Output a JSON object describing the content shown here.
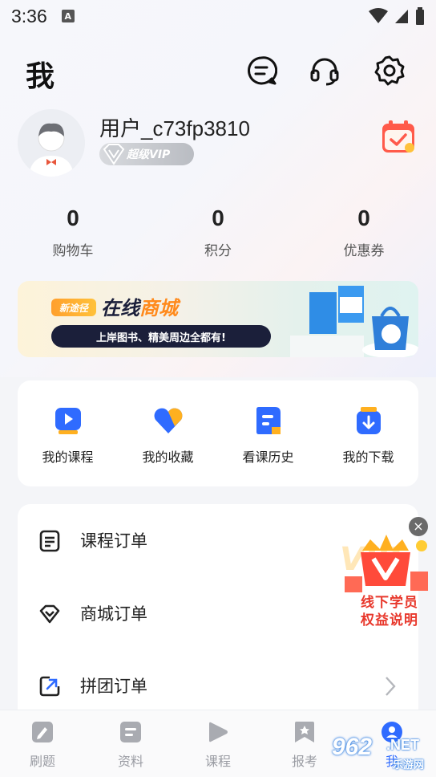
{
  "status_bar": {
    "time": "3:36",
    "badge": "A"
  },
  "header": {
    "title": "我"
  },
  "profile": {
    "username": "用户_c73fp3810",
    "vip_label": "超级VIP"
  },
  "stats": [
    {
      "value": "0",
      "label": "购物车"
    },
    {
      "value": "0",
      "label": "积分"
    },
    {
      "value": "0",
      "label": "优惠券"
    }
  ],
  "banner": {
    "tag": "新途径",
    "title_a": "在线",
    "title_b": "商城",
    "subtitle": "上岸图书、精美周边全都有!"
  },
  "quick_links": [
    {
      "label": "我的课程",
      "icon": "play-icon"
    },
    {
      "label": "我的收藏",
      "icon": "heart-icon"
    },
    {
      "label": "看课历史",
      "icon": "history-icon"
    },
    {
      "label": "我的下载",
      "icon": "download-icon"
    }
  ],
  "orders": [
    {
      "label": "课程订单",
      "icon": "document-icon"
    },
    {
      "label": "商城订单",
      "icon": "diamond-icon"
    },
    {
      "label": "拼团订单",
      "icon": "share-box-icon"
    }
  ],
  "vip_float": {
    "line1": "线下学员",
    "line2": "权益说明",
    "close": "×"
  },
  "tabs": [
    {
      "label": "刷题",
      "active": false
    },
    {
      "label": "资料",
      "active": false
    },
    {
      "label": "课程",
      "active": false
    },
    {
      "label": "报考",
      "active": false
    },
    {
      "label": "我",
      "active": true
    }
  ],
  "watermark": {
    "num": "962",
    "net": ".NET",
    "cn": "乐游网"
  },
  "colors": {
    "accent": "#2f6bff",
    "orange": "#ff8a1c",
    "red": "#e8382c"
  }
}
